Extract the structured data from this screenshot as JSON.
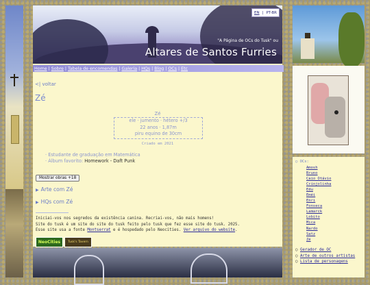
{
  "lang": {
    "en": "EN",
    "separator": "|",
    "ptbr": "PT-BR"
  },
  "header": {
    "subtitle": "\"A Página de OCs do Tusk\" ou",
    "title": "Altares de Santos Furries"
  },
  "nav": [
    {
      "label": "Home"
    },
    {
      "label": "Sobre"
    },
    {
      "label": "Tabela de encomendas"
    },
    {
      "label": "Galeria"
    },
    {
      "label": "HQs"
    },
    {
      "label": "Blog"
    },
    {
      "label": "OCs"
    },
    {
      "label": "Etc"
    }
  ],
  "nav_separator": "|",
  "main": {
    "back": "<| voltar",
    "page_title": "Zé",
    "char_name": "Zé",
    "info_line1": "ele · jumento · hétero +/3",
    "info_line2": "22 anos · 1,87m",
    "info_line3": "piru equino de 30cm",
    "created": "Criado em 2021",
    "fact1_label": "· Estudante de graduação em Matemática",
    "fact2_label": "· Álbum favorito: ",
    "fact2_value": "Homework - Daft Punk",
    "nsfw_button": "Mostrar obras +18",
    "section_art": "Arte com Zé",
    "section_hq": "HQs com Zé",
    "footer_line1": "Iniciai-vos nos segredos da existência canina. Recriai-vos, não mais homens!",
    "footer_line2": "Site do tusk é um site do site do tusk feito pelo tusk que fez esse site do tusk. 2025.",
    "footer_line3_a": "Esse site usa a fonte ",
    "footer_font_link": "Montserrat",
    "footer_line3_b": " e é hospedado pelo Neocities. ",
    "footer_archive_link": "Ver arquivo do website",
    "footer_line3_c": ".",
    "badge_neocities": "NeoCities",
    "badge_tusk": "Tusk's Tavern"
  },
  "sidebar": {
    "ocs_heading": "○ OCs:",
    "ocs": [
      "Amosh",
      "Bruno",
      "Caio Otávio",
      "Crinjolinha",
      "Edu",
      "Eméi",
      "Enri",
      "Fonseca",
      "Lamarck",
      "Lobito",
      "Mica",
      "Nardo",
      "Satz",
      "Zé"
    ],
    "links": [
      {
        "bullet": "○ ",
        "label": "Gerador de OC"
      },
      {
        "bullet": "○ ",
        "label": "Arte de outros artistas"
      },
      {
        "bullet": "○ ",
        "label": "Lista de personagens"
      }
    ]
  }
}
